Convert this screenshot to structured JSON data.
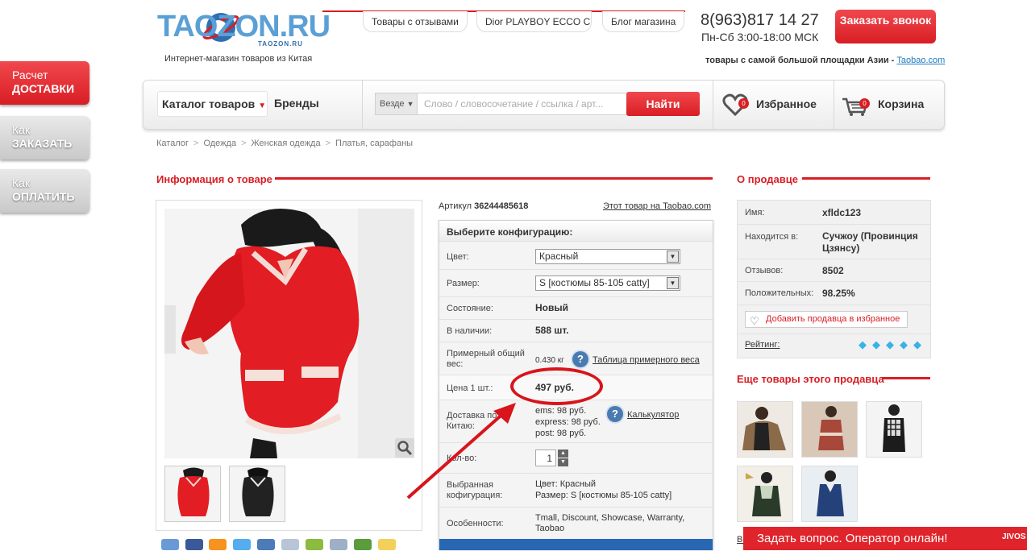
{
  "side_menu": [
    {
      "line1": "Расчет",
      "line2": "ДОСТАВКИ"
    },
    {
      "line1": "Как",
      "line2": "ЗАКАЗАТЬ"
    },
    {
      "line1": "Как",
      "line2": "ОПЛАТИТЬ"
    }
  ],
  "header": {
    "logo_text": "TAOZON.RU",
    "logo_sub": "TAOZON.RU",
    "tagline": "Интернет-магазин товаров из Китая",
    "top_links": [
      "Товары с отзывами",
      "Dior PLAYBOY ECCO C",
      "Блог магазина"
    ],
    "phone": "8(963)817 14 27",
    "hours": "Пн-Сб 3:00-18:00 МСК",
    "call_button": "Заказать звонок",
    "asia_text": "товары с самой большой площадки Азии -",
    "asia_link": "Taobao.com"
  },
  "nav": {
    "catalog": "Каталог товаров",
    "brands": "Бренды",
    "search_scope": "Везде",
    "search_placeholder": "Слово / словосочетание / ссылка / арт...",
    "search_button": "Найти",
    "favorites_label": "Избранное",
    "favorites_count": "0",
    "cart_label": "Корзина",
    "cart_count": "0"
  },
  "breadcrumb": [
    "Каталог",
    "Одежда",
    "Женская одежда",
    "Платья, сарафаны"
  ],
  "product": {
    "section_title": "Информация о товаре",
    "article_label": "Артикул",
    "article_value": "36244485618",
    "taobao_link": "Этот товар на Taobao.com",
    "config_title": "Выберите конфигурацию:",
    "color_label": "Цвет:",
    "color_value": "Красный",
    "size_label": "Размер:",
    "size_value": "S [костюмы 85-105 catty]",
    "condition_label": "Состояние:",
    "condition_value": "Новый",
    "stock_label": "В наличии:",
    "stock_value": "588 шт.",
    "weight_label": "Примерный общий вес:",
    "weight_value": "0.430 кг",
    "weight_link": "Таблица примерного веса",
    "price_label": "Цена 1 шт.:",
    "price_value": "497 руб.",
    "delivery_label": "Доставка по Китаю:",
    "delivery_ems": "ems: 98 руб.",
    "delivery_express": "express: 98 руб.",
    "delivery_post": "post: 98 руб.",
    "calculator_link": "Калькулятор",
    "qty_label": "Кол-во:",
    "qty_value": "1",
    "selected_label": "Выбранная кофигурация:",
    "selected_color": "Цвет: Красный",
    "selected_size": "Размер: S [костюмы 85-105 catty]",
    "features_label": "Особенности:",
    "features_value": "Tmall, Discount, Showcase, Warranty, Taobao"
  },
  "seller": {
    "section_title": "О продавце",
    "name_label": "Имя:",
    "name_value": "xfldc123",
    "location_label": "Находится в:",
    "location_value": "Сучжоу (Провинция Цзянсу)",
    "reviews_label": "Отзывов:",
    "reviews_value": "8502",
    "positive_label": "Положительных:",
    "positive_value": "98.25%",
    "add_button": "Добавить продавца в избранное",
    "rating_label": "Рейтинг:",
    "rating_diamonds": 5,
    "more_title": "Еще товары этого продавца",
    "more_cut_text": "Вс"
  },
  "chat": {
    "text": "Задать вопрос. Оператор онлайн!",
    "brand": "JIVOS"
  },
  "colors": {
    "accent_red": "#d81e24",
    "link_blue": "#1c7ac0",
    "diamond_blue": "#37b3e8"
  }
}
